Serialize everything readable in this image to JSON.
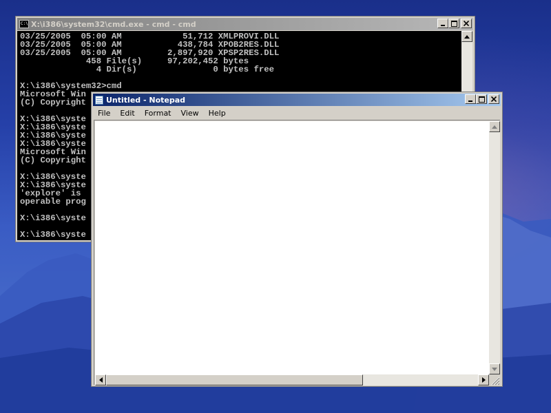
{
  "colors": {
    "desktop": "#2d48b3",
    "cmd_background": "#000000",
    "cmd_text": "#c0c0c0",
    "active_title": "#0a246a",
    "inactive_title": "#808080",
    "window_face": "#d4d0c8"
  },
  "cmd_window": {
    "title": "X:\\i386\\system32\\cmd.exe - cmd - cmd",
    "icon": "cmd-icon",
    "lines": [
      "03/25/2005  05:00 AM            51,712 XMLPROVI.DLL",
      "03/25/2005  05:00 AM           438,784 XPOB2RES.DLL",
      "03/25/2005  05:00 AM         2,897,920 XPSP2RES.DLL",
      "             458 File(s)     97,202,452 bytes",
      "               4 Dir(s)               0 bytes free",
      "",
      "X:\\i386\\system32>cmd",
      "Microsoft Win",
      "(C) Copyright",
      "",
      "X:\\i386\\syste",
      "X:\\i386\\syste",
      "X:\\i386\\syste",
      "X:\\i386\\syste",
      "Microsoft Win",
      "(C) Copyright",
      "",
      "X:\\i386\\syste",
      "X:\\i386\\syste",
      "'explore' is",
      "operable prog",
      "",
      "X:\\i386\\syste",
      "",
      "X:\\i386\\syste"
    ]
  },
  "notepad_window": {
    "title": "Untitled - Notepad",
    "icon": "notepad-icon",
    "menu": [
      "File",
      "Edit",
      "Format",
      "View",
      "Help"
    ],
    "content": ""
  }
}
